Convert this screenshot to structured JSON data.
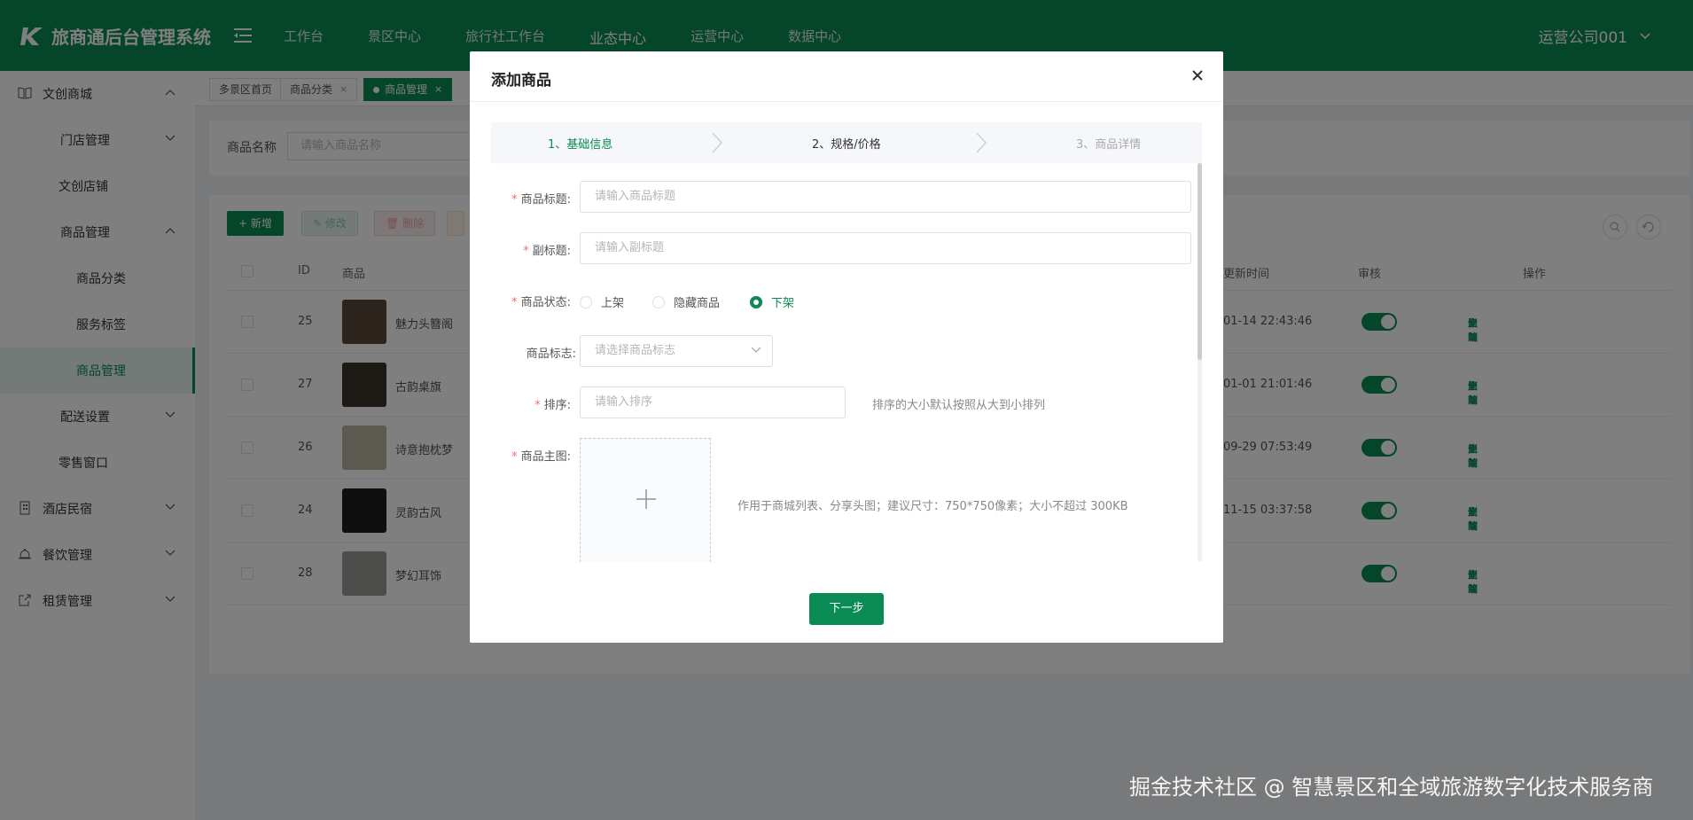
{
  "header": {
    "app_title": "旅商通后台管理系统",
    "nav": [
      "工作台",
      "景区中心",
      "旅行社工作台",
      "业态中心",
      "运营中心",
      "数据中心"
    ],
    "active_nav": "业态中心",
    "user": "运营公司001"
  },
  "sidebar": {
    "items": [
      {
        "label": "文创商城",
        "icon": "book-icon",
        "expanded": true
      },
      {
        "label": "门店管理"
      },
      {
        "label": "文创店铺"
      },
      {
        "label": "商品管理",
        "expanded": true
      },
      {
        "label": "商品分类"
      },
      {
        "label": "服务标签"
      },
      {
        "label": "商品管理",
        "active": true
      },
      {
        "label": "配送设置"
      },
      {
        "label": "零售窗口"
      },
      {
        "label": "酒店民宿",
        "icon": "building-icon"
      },
      {
        "label": "餐饮管理",
        "icon": "bell-icon"
      },
      {
        "label": "租赁管理",
        "icon": "export-icon"
      }
    ]
  },
  "tabs": [
    "多景区首页",
    "商品分类",
    "商品管理"
  ],
  "search": {
    "label": "商品名称",
    "placeholder": "请输入商品名称"
  },
  "toolbar": {
    "add": "新增",
    "edit": "修改",
    "delete": "删除"
  },
  "table": {
    "headers": {
      "id": "ID",
      "product": "商品",
      "updated": "更新时间",
      "review": "审核",
      "ops": "操作"
    },
    "rows": [
      {
        "id": "25",
        "name": "魅力头簪阁",
        "updated": "01-14 22:43:46",
        "enabled": true
      },
      {
        "id": "27",
        "name": "古韵桌旗",
        "updated": "01-01 21:01:46",
        "enabled": true
      },
      {
        "id": "26",
        "name": "诗意抱枕梦",
        "updated": "09-29 07:53:49",
        "enabled": true
      },
      {
        "id": "24",
        "name": "灵韵古风",
        "updated": "11-15 03:37:58",
        "enabled": true
      },
      {
        "id": "28",
        "name": "梦幻耳饰",
        "updated": "",
        "enabled": true
      }
    ],
    "ops": [
      "上架",
      "修改",
      "复制",
      "删除"
    ]
  },
  "dialog": {
    "title": "添加商品",
    "steps": [
      "1、基础信息",
      "2、规格/价格",
      "3、商品详情"
    ],
    "fields": {
      "title_label": "商品标题:",
      "title_placeholder": "请输入商品标题",
      "subtitle_label": "副标题:",
      "subtitle_placeholder": "请输入副标题",
      "status_label": "商品状态:",
      "status_options": [
        "上架",
        "隐藏商品",
        "下架"
      ],
      "status_selected": "下架",
      "tag_label": "商品标志:",
      "tag_placeholder": "请选择商品标志",
      "sort_label": "排序:",
      "sort_placeholder": "请输入排序",
      "sort_hint": "排序的大小默认按照从大到小排列",
      "image_label": "商品主图:",
      "image_hint": "作用于商城列表、分享头图；建议尺寸：750*750像素；大小不超过 300KB"
    },
    "next": "下一步"
  },
  "watermark": "掘金技术社区 @ 智慧景区和全域旅游数字化技术服务商",
  "colors": {
    "brand": "#0a8a55",
    "required": "#f56c6c"
  }
}
